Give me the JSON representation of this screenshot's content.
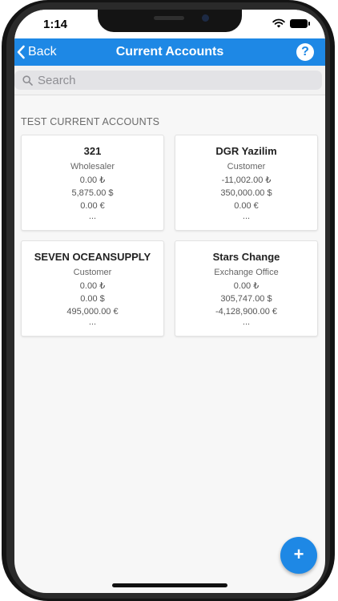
{
  "status_bar": {
    "time": "1:14"
  },
  "nav": {
    "back_label": "Back",
    "title": "Current Accounts",
    "help_label": "?"
  },
  "search": {
    "placeholder": "Search"
  },
  "section": {
    "title": "TEST CURRENT ACCOUNTS"
  },
  "accounts": [
    {
      "name": "321",
      "type": "Wholesaler",
      "try": "0.00 ₺",
      "usd": "5,875.00 $",
      "eur": "0.00 €",
      "more": "..."
    },
    {
      "name": "DGR Yazilim",
      "type": "Customer",
      "try": "-11,002.00 ₺",
      "usd": "350,000.00 $",
      "eur": "0.00 €",
      "more": "..."
    },
    {
      "name": "SEVEN OCEANSUPPLY",
      "type": "Customer",
      "try": "0.00 ₺",
      "usd": "0.00 $",
      "eur": "495,000.00 €",
      "more": "..."
    },
    {
      "name": "Stars Change",
      "type": "Exchange Office",
      "try": "0.00 ₺",
      "usd": "305,747.00 $",
      "eur": "-4,128,900.00 €",
      "more": "..."
    }
  ],
  "fab": {
    "label": "+"
  },
  "theme": {
    "accent": "#1e88e5",
    "background": "#f7f7f7"
  }
}
